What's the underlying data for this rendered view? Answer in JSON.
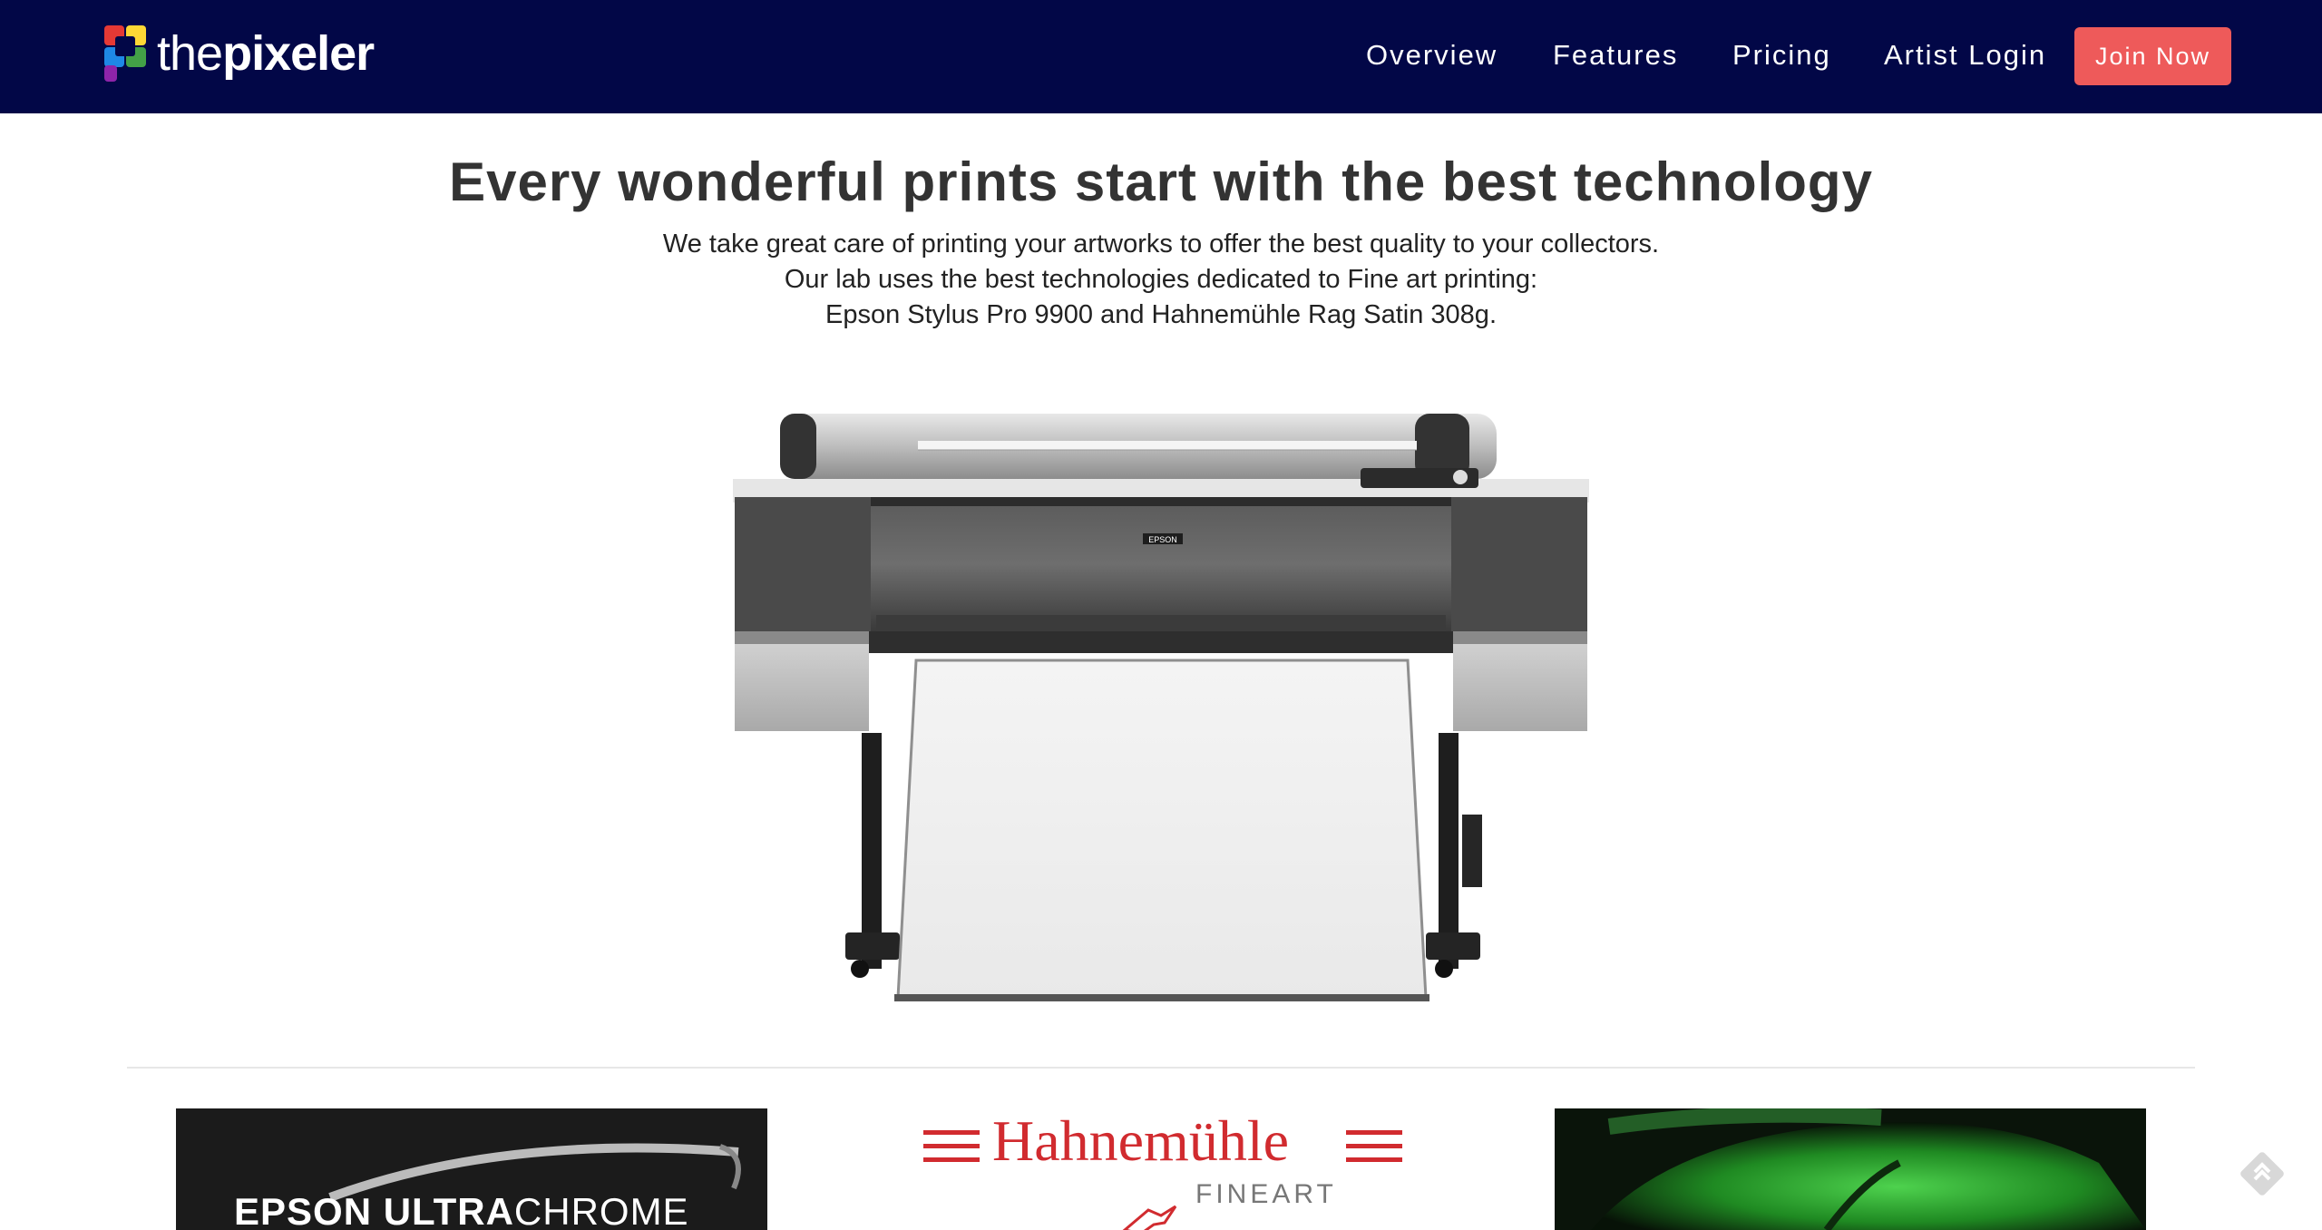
{
  "brand": {
    "logo_prefix": "the",
    "logo_suffix": "pixeler",
    "colors": {
      "navbar_bg": "#020747",
      "cta": "#ee5a5a",
      "text": "#333333"
    }
  },
  "nav": {
    "items": [
      {
        "label": "Overview"
      },
      {
        "label": "Features"
      },
      {
        "label": "Pricing"
      },
      {
        "label": "Artist Login"
      }
    ],
    "cta_label": "Join Now"
  },
  "hero": {
    "title": "Every wonderful prints start with the best technology",
    "lines": [
      "We take great care of printing your artworks to offer the best quality to your collectors.",
      "Our lab uses the best technologies dedicated to Fine art printing:",
      "Epson Stylus Pro 9900 and Hahnemühle Rag Satin 308g."
    ]
  },
  "printer_image": {
    "brand_label": "EPSON"
  },
  "cards": {
    "epson": {
      "bold": "EPSON ULTRA",
      "light": "CHROME"
    },
    "hahnemuhle": {
      "name": "Hahnemühle",
      "sub": "FINEART"
    }
  },
  "icons": {
    "logo": "pixeler-logo-icon",
    "feed": "feedback-icon"
  }
}
